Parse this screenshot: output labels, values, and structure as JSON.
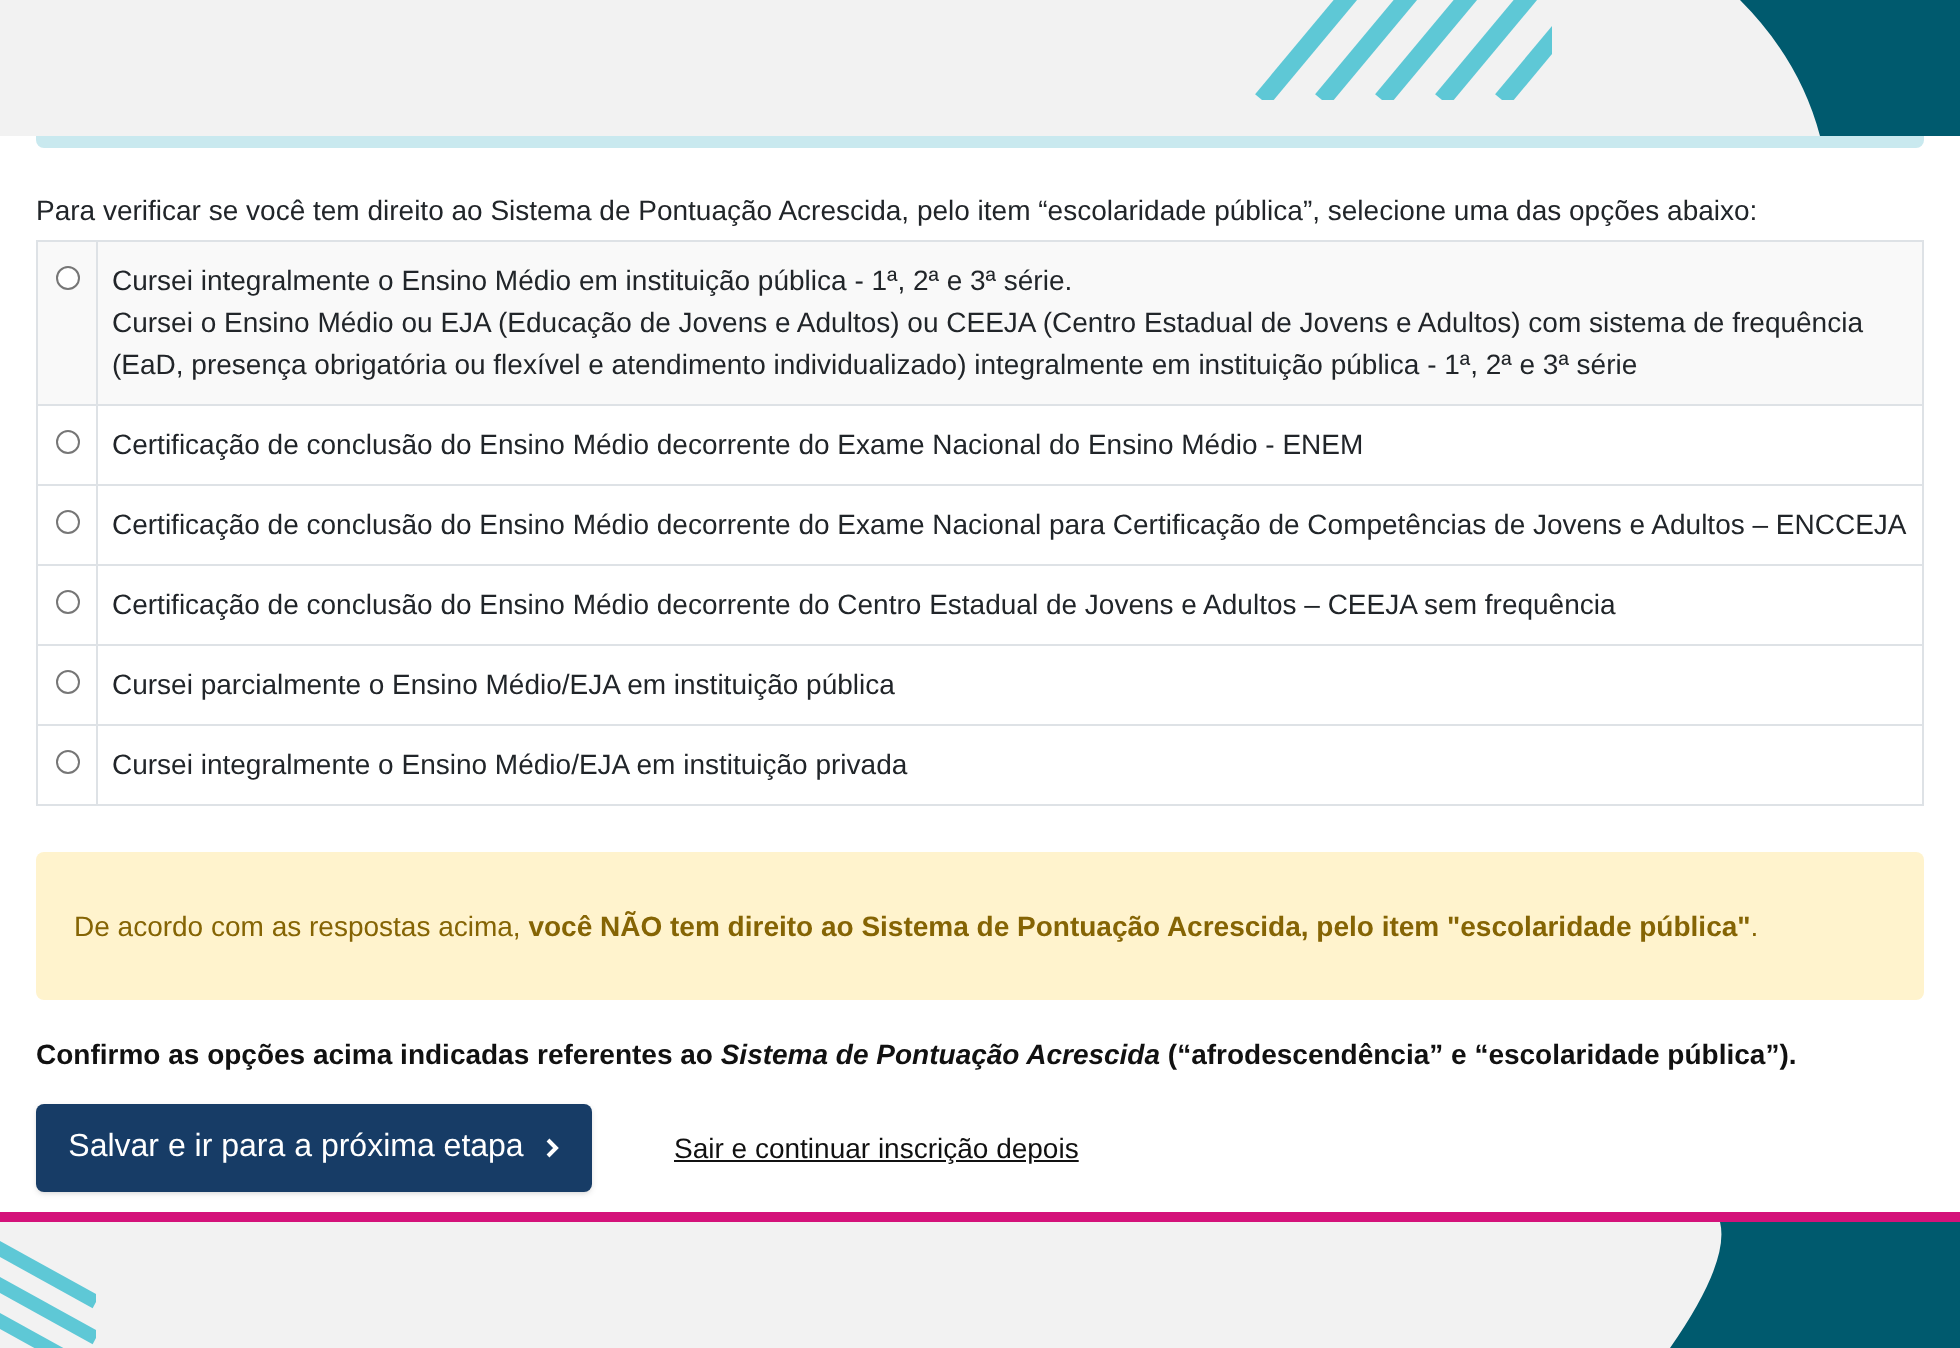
{
  "intro": "Para verificar se você tem direito ao Sistema de Pontuação Acrescida, pelo item “escolaridade pública”, selecione uma das opções abaixo:",
  "options": [
    {
      "selected": false,
      "lines": [
        "Cursei integralmente o Ensino Médio em instituição pública - 1ª, 2ª e 3ª série.",
        "Cursei o Ensino Médio ou EJA (Educação de Jovens e Adultos) ou CEEJA (Centro Estadual de Jovens e Adultos) com sistema de frequência (EaD, presença obrigatória ou flexível e atendimento individualizado) integralmente em instituição pública - 1ª, 2ª e 3ª série"
      ]
    },
    {
      "selected": false,
      "lines": [
        "Certificação de conclusão do Ensino Médio decorrente do Exame Nacional do Ensino Médio - ENEM"
      ]
    },
    {
      "selected": false,
      "lines": [
        "Certificação de conclusão do Ensino Médio decorrente do Exame Nacional para Certificação de Competências de Jovens e Adultos – ENCCEJA"
      ]
    },
    {
      "selected": false,
      "lines": [
        "Certificação de conclusão do Ensino Médio decorrente do Centro Estadual de Jovens e Adultos – CEEJA sem frequência"
      ]
    },
    {
      "selected": false,
      "lines": [
        "Cursei parcialmente o Ensino Médio/EJA em instituição pública"
      ]
    },
    {
      "selected": false,
      "lines": [
        "Cursei integralmente o Ensino Médio/EJA em instituição privada"
      ]
    }
  ],
  "alert": "De acordo com as respostas acima, **você NÃO tem direito ao Sistema de Pontuação Acrescida, pelo item \"escolaridade pública\"**.",
  "confirm": "Confirmo as opções acima indicadas referentes ao *Sistema de Pontuação Acrescida* (“afrodescendência” e “escolaridade pública”).",
  "save_button": "Salvar e ir para a próxima etapa",
  "exit_link": "Sair e continuar inscrição depois"
}
